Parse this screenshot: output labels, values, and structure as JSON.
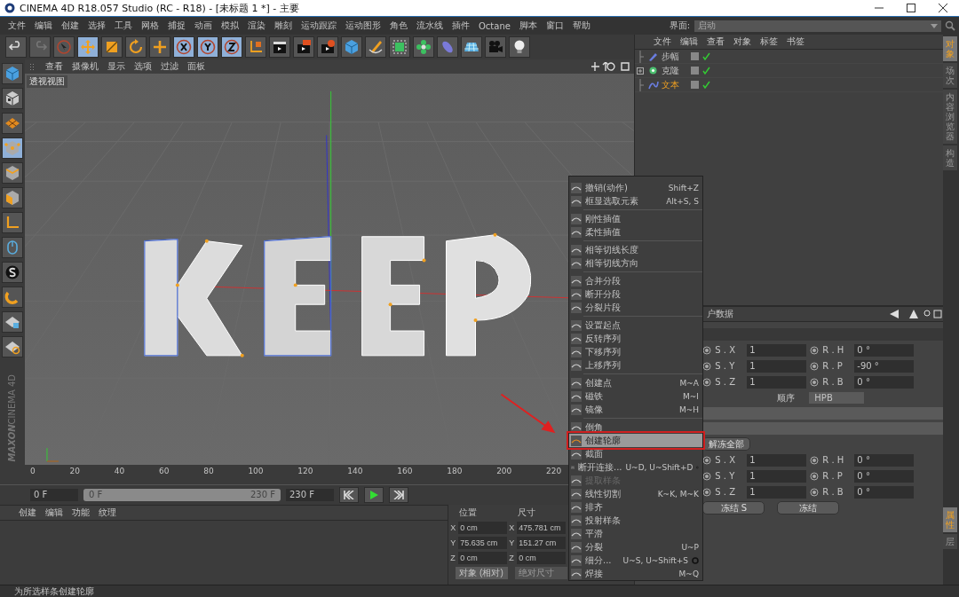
{
  "window": {
    "title": "CINEMA 4D R18.057 Studio (RC - R18) - [未标题 1 *] - 主要"
  },
  "menubar": [
    "文件",
    "编辑",
    "创建",
    "选择",
    "工具",
    "网格",
    "捕捉",
    "动画",
    "模拟",
    "渲染",
    "雕刻",
    "运动跟踪",
    "运动图形",
    "角色",
    "流水线",
    "插件",
    "Octane",
    "脚本",
    "窗口",
    "帮助"
  ],
  "layout_selector": {
    "label": "界面:",
    "value": "启动"
  },
  "toolbar": [
    {
      "kind": "undo",
      "selected": false
    },
    {
      "kind": "redo",
      "selected": false
    },
    {
      "kind": "select",
      "selected": false
    },
    {
      "kind": "move",
      "selected": true
    },
    {
      "kind": "scale",
      "selected": false
    },
    {
      "kind": "rotate",
      "selected": false
    },
    {
      "kind": "add",
      "selected": false
    },
    {
      "kind": "x",
      "selected": true
    },
    {
      "kind": "y",
      "selected": true
    },
    {
      "kind": "z",
      "selected": true
    },
    {
      "kind": "coords",
      "selected": false
    },
    {
      "kind": "render-view",
      "selected": false
    },
    {
      "kind": "render",
      "selected": false
    },
    {
      "kind": "render-settings",
      "selected": false
    },
    {
      "kind": "cube",
      "selected": false
    },
    {
      "kind": "pen",
      "selected": false
    },
    {
      "kind": "subdivide",
      "selected": false
    },
    {
      "kind": "cloner",
      "selected": false
    },
    {
      "kind": "deformer",
      "selected": false
    },
    {
      "kind": "floor",
      "selected": false
    },
    {
      "kind": "camera",
      "selected": false
    },
    {
      "kind": "light",
      "selected": false
    }
  ],
  "side_tools": [
    {
      "kind": "cube",
      "selected": false
    },
    {
      "kind": "checker",
      "selected": false
    },
    {
      "kind": "grid",
      "selected": false
    },
    {
      "kind": "points",
      "selected": true
    },
    {
      "kind": "edges",
      "selected": false
    },
    {
      "kind": "polygons",
      "selected": false
    },
    {
      "kind": "axis",
      "selected": false
    },
    {
      "kind": "mouse",
      "selected": false
    },
    {
      "kind": "s",
      "selected": false
    },
    {
      "kind": "magnet",
      "selected": false
    },
    {
      "kind": "lock",
      "selected": false
    },
    {
      "kind": "grid-lock",
      "selected": false
    }
  ],
  "viewport": {
    "menu": [
      "查看",
      "摄像机",
      "显示",
      "选项",
      "过滤",
      "面板"
    ],
    "label": "透视视图"
  },
  "timeline": {
    "ticks": [
      "0",
      "20",
      "40",
      "60",
      "80",
      "100",
      "120",
      "140",
      "160",
      "180",
      "200",
      "220"
    ]
  },
  "playback": {
    "current": "0 F",
    "range": {
      "start": "0 F",
      "end": "230 F",
      "level": 1
    },
    "end": "230 F"
  },
  "logo": {
    "brand": "MAXON",
    "product": "CINEMA 4D"
  },
  "materials": {
    "menu": [
      "创建",
      "编辑",
      "功能",
      "纹理"
    ]
  },
  "coordinates": {
    "position_label": "位置",
    "size_label": "尺寸",
    "rows": [
      {
        "axis": "X",
        "position": "0 cm",
        "size_axis": "X",
        "size": "475.781 cm"
      },
      {
        "axis": "Y",
        "position": "75.635 cm",
        "size_axis": "Y",
        "size": "151.27 cm"
      },
      {
        "axis": "Z",
        "position": "0 cm",
        "size_axis": "Z",
        "size": "0 cm"
      }
    ],
    "mode": "对象 (相对)",
    "size_mode": "绝对尺寸"
  },
  "object_manager": {
    "menu": [
      "文件",
      "编辑",
      "查看",
      "对象",
      "标签",
      "书签"
    ],
    "objects": [
      {
        "name": "步幅",
        "kind": "effector",
        "expandable": false,
        "selected": false
      },
      {
        "name": "克隆",
        "kind": "cloner",
        "expandable": true,
        "expanded": false,
        "selected": false
      },
      {
        "name": "文本",
        "kind": "text",
        "expandable": false,
        "selected": true
      }
    ]
  },
  "attribute_manager": {
    "tab": "户数据",
    "group_1": [
      {
        "label": "S . X",
        "value": "1",
        "label_2": "R . H",
        "value_2": "0 °"
      },
      {
        "label": "S . Y",
        "value": "1",
        "label_2": "R . P",
        "value_2": "-90 °"
      },
      {
        "label": "S . Z",
        "value": "1",
        "label_2": "R . B",
        "value_2": "0 °"
      }
    ],
    "order_label": "顺序",
    "order_value": "HPB",
    "unfreeze_button": "解冻全部",
    "group_2": [
      {
        "label": "S . X",
        "value": "1",
        "label_2": "R . H",
        "value_2": "0 °"
      },
      {
        "label": "S . Y",
        "value": "1",
        "label_2": "R . P",
        "value_2": "0 °"
      },
      {
        "label": "S . Z",
        "value": "1",
        "label_2": "R . B",
        "value_2": "0 °"
      }
    ],
    "freeze_buttons": [
      "冻结 S",
      "冻结"
    ]
  },
  "side_tabs_top": [
    {
      "label": "对象",
      "selected": true
    },
    {
      "label": "场次",
      "selected": false
    },
    {
      "label": "内容浏览器",
      "selected": false
    },
    {
      "label": "构造",
      "selected": false
    }
  ],
  "side_tabs_bottom": [
    {
      "label": "属性",
      "selected": true
    },
    {
      "label": "层",
      "selected": false
    }
  ],
  "context_menu": [
    {
      "kind": "item",
      "label": "撤销(动作)",
      "shortcut": "Shift+Z",
      "selected": false,
      "disabled": false,
      "options": false
    },
    {
      "kind": "item",
      "label": "框显选取元素",
      "shortcut": "Alt+S, S",
      "selected": false,
      "disabled": false,
      "options": false
    },
    {
      "kind": "separator"
    },
    {
      "kind": "item",
      "label": "刚性插值",
      "selected": false,
      "disabled": false,
      "options": false
    },
    {
      "kind": "item",
      "label": "柔性插值",
      "selected": false,
      "disabled": false,
      "options": false
    },
    {
      "kind": "separator"
    },
    {
      "kind": "item",
      "label": "相等切线长度",
      "selected": false,
      "disabled": false,
      "options": false
    },
    {
      "kind": "item",
      "label": "相等切线方向",
      "selected": false,
      "disabled": false,
      "options": false
    },
    {
      "kind": "separator"
    },
    {
      "kind": "item",
      "label": "合并分段",
      "selected": false,
      "disabled": false,
      "options": false
    },
    {
      "kind": "item",
      "label": "断开分段",
      "selected": false,
      "disabled": false,
      "options": false
    },
    {
      "kind": "item",
      "label": "分裂片段",
      "selected": false,
      "disabled": false,
      "options": false
    },
    {
      "kind": "separator"
    },
    {
      "kind": "item",
      "label": "设置起点",
      "selected": false,
      "disabled": false,
      "options": false
    },
    {
      "kind": "item",
      "label": "反转序列",
      "selected": false,
      "disabled": false,
      "options": false
    },
    {
      "kind": "item",
      "label": "下移序列",
      "selected": false,
      "disabled": false,
      "options": false
    },
    {
      "kind": "item",
      "label": "上移序列",
      "selected": false,
      "disabled": false,
      "options": false
    },
    {
      "kind": "separator"
    },
    {
      "kind": "item",
      "label": "创建点",
      "shortcut": "M~A",
      "selected": false,
      "disabled": false,
      "options": false
    },
    {
      "kind": "item",
      "label": "磁铁",
      "shortcut": "M~I",
      "selected": false,
      "disabled": false,
      "options": false
    },
    {
      "kind": "item",
      "label": "镜像",
      "shortcut": "M~H",
      "selected": false,
      "disabled": false,
      "options": false
    },
    {
      "kind": "separator"
    },
    {
      "kind": "item",
      "label": "倒角",
      "selected": false,
      "disabled": false,
      "options": false
    },
    {
      "kind": "item",
      "label": "创建轮廓",
      "selected": true,
      "disabled": false,
      "options": false
    },
    {
      "kind": "item",
      "label": "截面",
      "selected": false,
      "disabled": false,
      "options": false
    },
    {
      "kind": "item",
      "label": "断开连接...",
      "shortcut": "U~D, U~Shift+D",
      "selected": false,
      "disabled": false,
      "options": true
    },
    {
      "kind": "item",
      "label": "提取样条",
      "selected": false,
      "disabled": true,
      "options": false
    },
    {
      "kind": "item",
      "label": "线性切割",
      "shortcut": "K~K, M~K",
      "selected": false,
      "disabled": false,
      "options": false
    },
    {
      "kind": "item",
      "label": "排齐",
      "selected": false,
      "disabled": false,
      "options": false
    },
    {
      "kind": "item",
      "label": "投射样条",
      "selected": false,
      "disabled": false,
      "options": false
    },
    {
      "kind": "item",
      "label": "平滑",
      "selected": false,
      "disabled": false,
      "options": false
    },
    {
      "kind": "item",
      "label": "分裂",
      "shortcut": "U~P",
      "selected": false,
      "disabled": false,
      "options": false
    },
    {
      "kind": "item",
      "label": "细分...",
      "shortcut": "U~S, U~Shift+S",
      "selected": false,
      "disabled": false,
      "options": true
    },
    {
      "kind": "item",
      "label": "焊接",
      "shortcut": "M~Q",
      "selected": false,
      "disabled": false,
      "options": false
    }
  ],
  "status_bar": "为所选样条创建轮廓"
}
